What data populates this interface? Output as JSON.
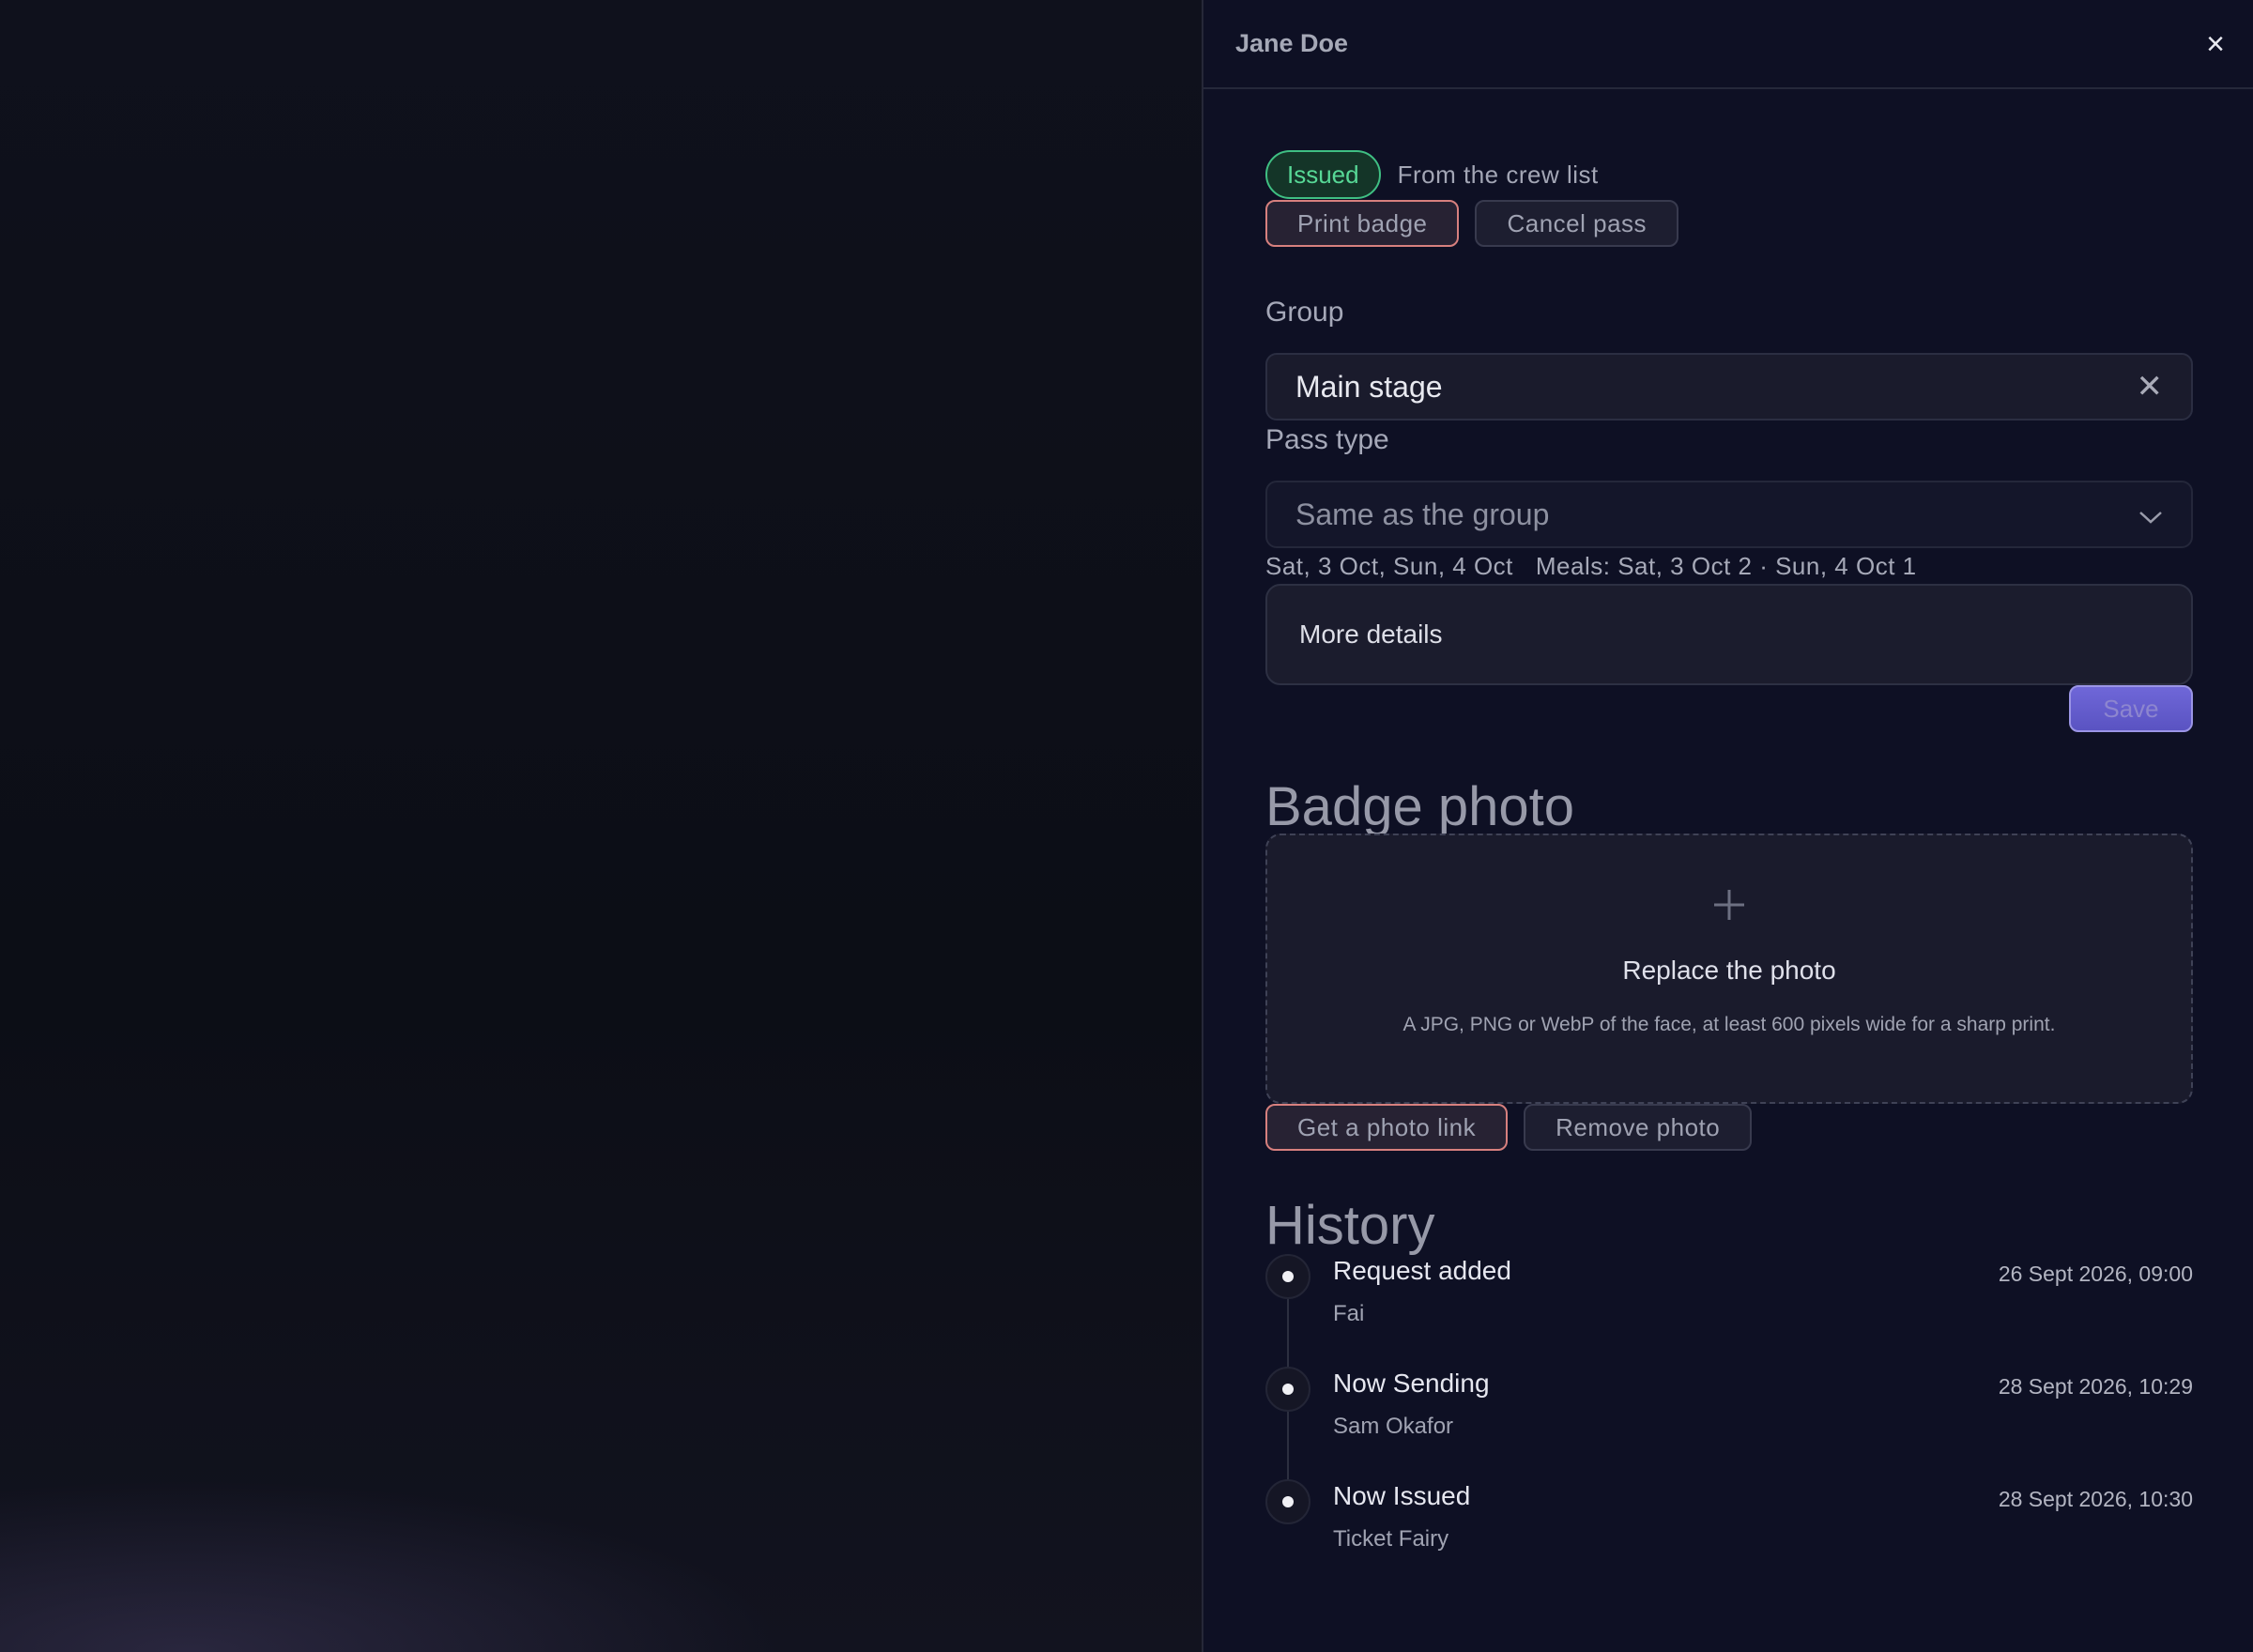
{
  "drawer": {
    "title": "Jane Doe",
    "close_label": "×"
  },
  "status": {
    "chip": "Issued",
    "source": "From the crew list",
    "actions": [
      "Print badge",
      "Cancel pass"
    ]
  },
  "form": {
    "group_label": "Group",
    "group_value": "Main stage",
    "group_clear_icon": "close-icon",
    "pass_type_label": "Pass type",
    "pass_type_value": "Same as the group",
    "pass_type_icon": "chevron-down-icon",
    "dates": "Sat, 3 Oct, Sun, 4 Oct",
    "meals": "Meals: Sat, 3 Oct 2 · Sun, 4 Oct 1",
    "more_details": "More details",
    "save": "Save"
  },
  "photo": {
    "title": "Badge photo",
    "drop_icon": "plus-icon",
    "drop_title": "Replace the photo",
    "drop_hint": "A JPG, PNG or WebP of the face, at least 600 pixels wide for a sharp print.",
    "actions": [
      "Get a photo link",
      "Remove photo"
    ]
  },
  "history": {
    "title": "History",
    "events": [
      {
        "title": "Request added",
        "person": "Fai",
        "time": "26 Sept 2026, 09:00"
      },
      {
        "title": "Now Sending",
        "person": "Sam Okafor",
        "time": "28 Sept 2026, 10:29"
      },
      {
        "title": "Now Issued",
        "person": "Ticket Fairy",
        "time": "28 Sept 2026, 10:30"
      }
    ]
  },
  "colors": {
    "accent": "#6f67d8",
    "issued_green": "#57d896",
    "danger_border": "#d7807e"
  }
}
